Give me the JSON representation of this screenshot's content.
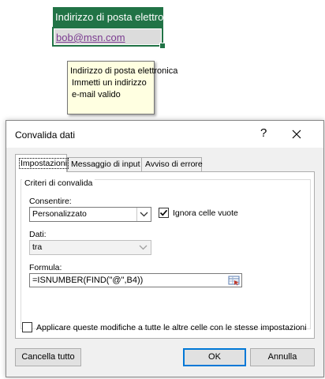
{
  "sheet": {
    "header_cell": "Indirizzo di posta elettronica",
    "selected_cell": "bob@msn.com"
  },
  "tooltip": {
    "title": "Indirizzo di posta elettronica",
    "body": "Immetti un indirizzo e-mail valido"
  },
  "dialog": {
    "title": "Convalida dati",
    "help_label": "?",
    "tabs": [
      {
        "label": "Impostazioni",
        "active": true
      },
      {
        "label": "Messaggio di input",
        "active": false
      },
      {
        "label": "Avviso di errore",
        "active": false
      }
    ],
    "group_label": "Criteri di convalida",
    "allow_label": "Consentire:",
    "allow_value": "Personalizzato",
    "ignore_blank_label": "Ignora celle vuote",
    "ignore_blank_checked": true,
    "data_label": "Dati:",
    "data_value": "tra",
    "formula_label": "Formula:",
    "formula_value": "=ISNUMBER(FIND(\"@\",B4))",
    "apply_all_label": "Applicare queste modifiche a tutte le altre celle con le stesse impostazioni",
    "apply_all_checked": false,
    "clear_all_label": "Cancella tutto",
    "ok_label": "OK",
    "cancel_label": "Annulla"
  },
  "colors": {
    "excel_green": "#217346",
    "tooltip_bg": "#ffffe1",
    "hyperlink": "#7a3b90",
    "focus_blue": "#0078d7"
  },
  "icons": [
    "close-icon",
    "checkmark-icon",
    "chevron-down-icon",
    "range-selector-icon"
  ]
}
